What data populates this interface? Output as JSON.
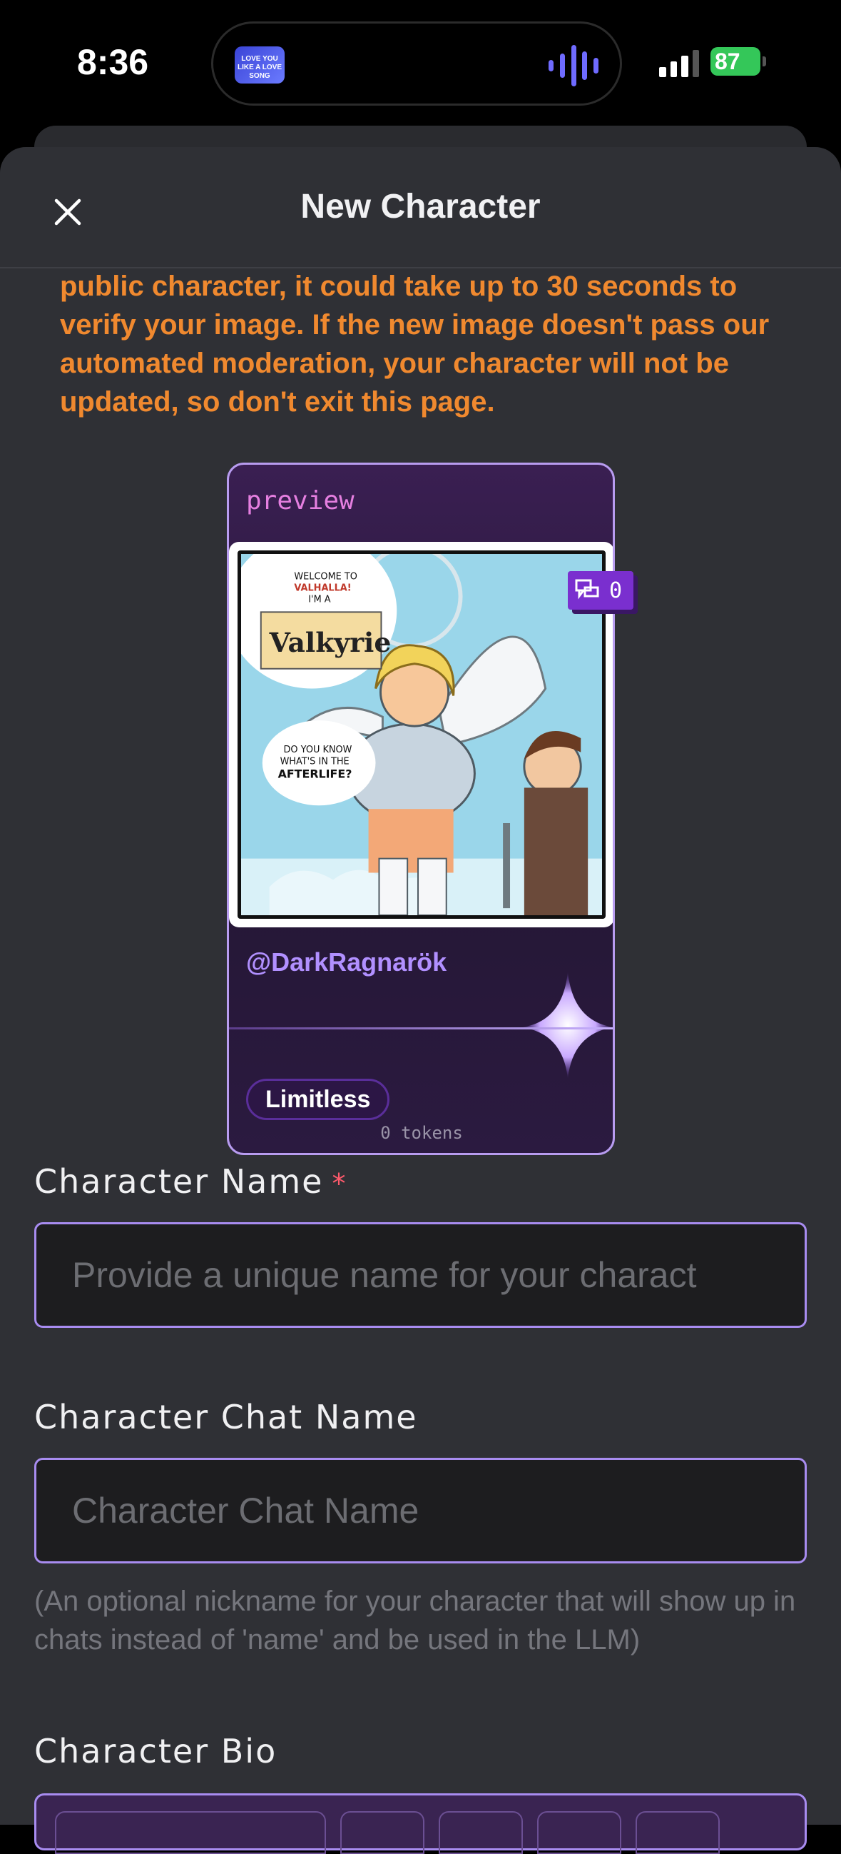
{
  "status_bar": {
    "time": "8:36",
    "now_playing_art": "LOVE YOU LIKE A LOVE SONG",
    "battery": "87"
  },
  "header": {
    "title": "New Character"
  },
  "warning": {
    "text": "public character, it could take up to 30 seconds to verify your image. If the new image doesn't pass our automated moderation, your character will not be updated, so don't exit this page."
  },
  "preview_card": {
    "label": "preview",
    "chat_count": "0",
    "username": "@DarkRagnarök",
    "tag": "Limitless",
    "tokens": "0 tokens",
    "comic": {
      "line1": "WELCOME TO",
      "line2": "VALHALLA!",
      "line3": "I'M A",
      "logo": "Valkyrie",
      "bubble2_line1": "DO YOU KNOW",
      "bubble2_line2": "WHAT'S IN THE",
      "bubble2_line3": "AFTERLIFE?"
    }
  },
  "form": {
    "name_label": "Character Name",
    "name_required": "*",
    "name_placeholder": "Provide a unique name for your charact",
    "chat_name_label": "Character Chat Name",
    "chat_name_placeholder": "Character Chat Name",
    "chat_name_helper": "(An optional nickname for your character that will show up in chats instead of 'name' and be used in the LLM)",
    "bio_label": "Character Bio"
  },
  "colors": {
    "accent": "#a88cf0",
    "warning": "#f0892f",
    "sheet_bg": "#2f3035"
  }
}
